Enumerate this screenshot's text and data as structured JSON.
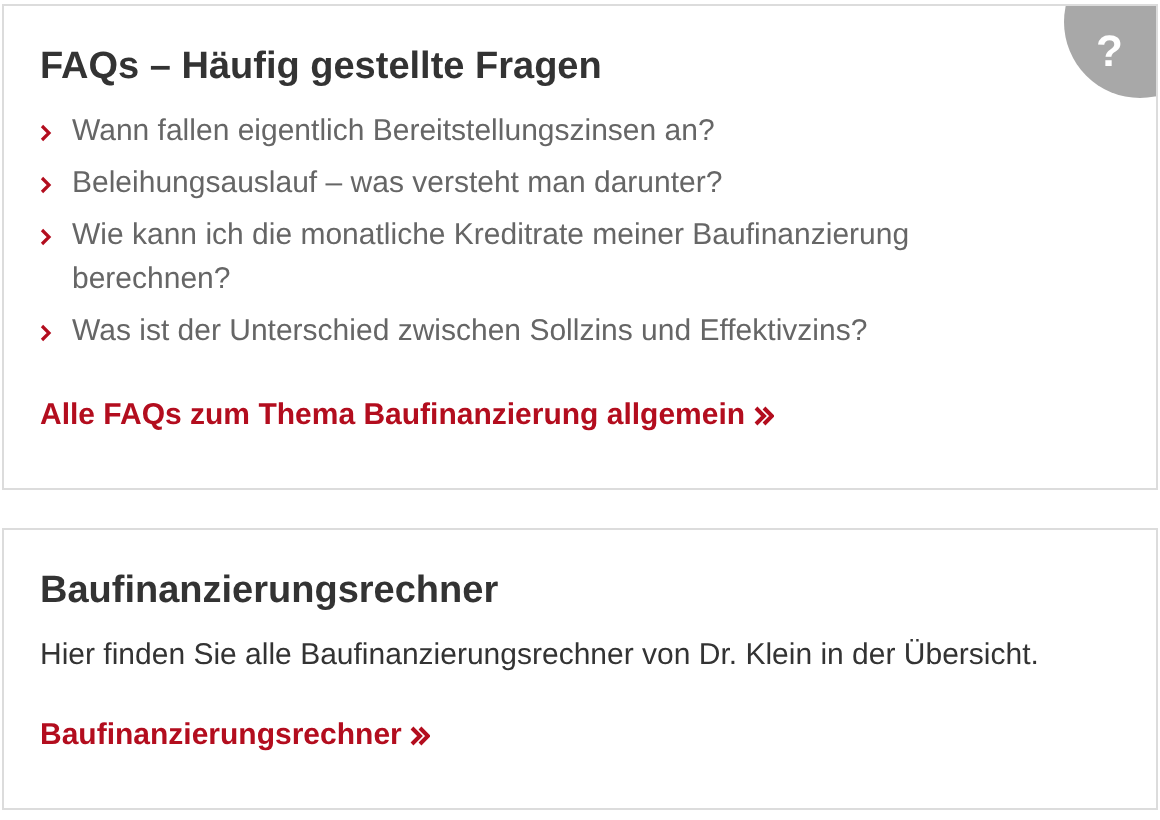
{
  "faq_card": {
    "badge": "?",
    "title": "FAQs – Häufig gestellte Fragen",
    "questions": [
      "Wann fallen eigentlich Bereitstellungszinsen an?",
      "Beleihungsauslauf – was versteht man darunter?",
      "Wie kann ich die monatliche Kreditrate meiner Baufinanzierung berechnen?",
      "Was ist der Unterschied zwischen Sollzins und Effektivzins?"
    ],
    "link": "Alle FAQs zum Thema Baufinanzierung allgemein"
  },
  "calculator_card": {
    "title": "Baufinanzierungsrechner",
    "text": "Hier finden Sie alle Baufinanzierungsrechner von Dr. Klein in der Übersicht.",
    "link": "Baufinanzierungsrechner"
  }
}
